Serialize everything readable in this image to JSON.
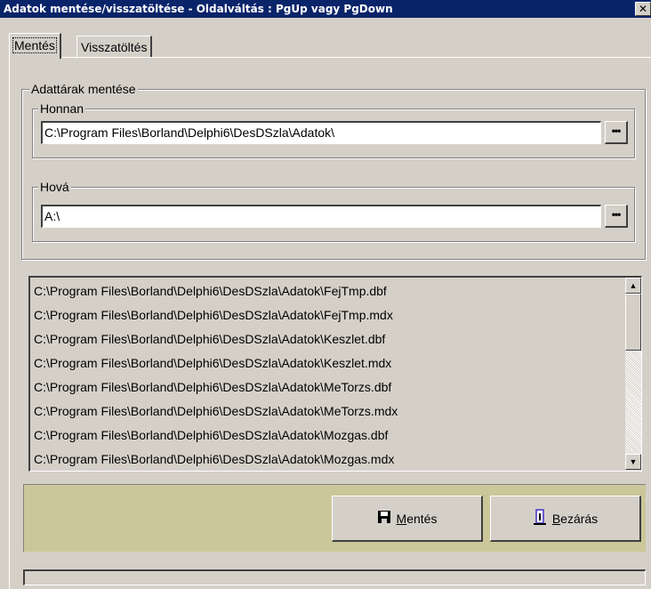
{
  "window": {
    "title": "Adatok mentése/visszatöltése - Oldalváltás : PgUp vagy PgDown",
    "close_label": "✕"
  },
  "tabs": [
    {
      "label": "Mentés",
      "active": true
    },
    {
      "label": "Visszatöltés",
      "active": false
    }
  ],
  "save_group": {
    "legend": "Adattárak mentése",
    "source": {
      "legend": "Honnan",
      "value": "C:\\Program Files\\Borland\\Delphi6\\DesDSzla\\Adatok\\",
      "browse_label": "•••"
    },
    "target": {
      "legend": "Hová",
      "value": "A:\\",
      "browse_label": "•••"
    }
  },
  "file_list": [
    "C:\\Program Files\\Borland\\Delphi6\\DesDSzla\\Adatok\\FejTmp.dbf",
    "C:\\Program Files\\Borland\\Delphi6\\DesDSzla\\Adatok\\FejTmp.mdx",
    "C:\\Program Files\\Borland\\Delphi6\\DesDSzla\\Adatok\\Keszlet.dbf",
    "C:\\Program Files\\Borland\\Delphi6\\DesDSzla\\Adatok\\Keszlet.mdx",
    "C:\\Program Files\\Borland\\Delphi6\\DesDSzla\\Adatok\\MeTorzs.dbf",
    "C:\\Program Files\\Borland\\Delphi6\\DesDSzla\\Adatok\\MeTorzs.mdx",
    "C:\\Program Files\\Borland\\Delphi6\\DesDSzla\\Adatok\\Mozgas.dbf",
    "C:\\Program Files\\Borland\\Delphi6\\DesDSzla\\Adatok\\Mozgas.mdx"
  ],
  "buttons": {
    "save": {
      "label": "Mentés",
      "accelerator": "M",
      "rest": "entés",
      "icon": "floppy-disk-icon"
    },
    "close": {
      "label": "Bezárás",
      "accelerator": "B",
      "rest": "ezárás",
      "icon": "door-exit-icon"
    }
  },
  "colors": {
    "titlebar": "#0a246a",
    "button_panel": "#cbc79a",
    "face": "#d4d0c8"
  }
}
